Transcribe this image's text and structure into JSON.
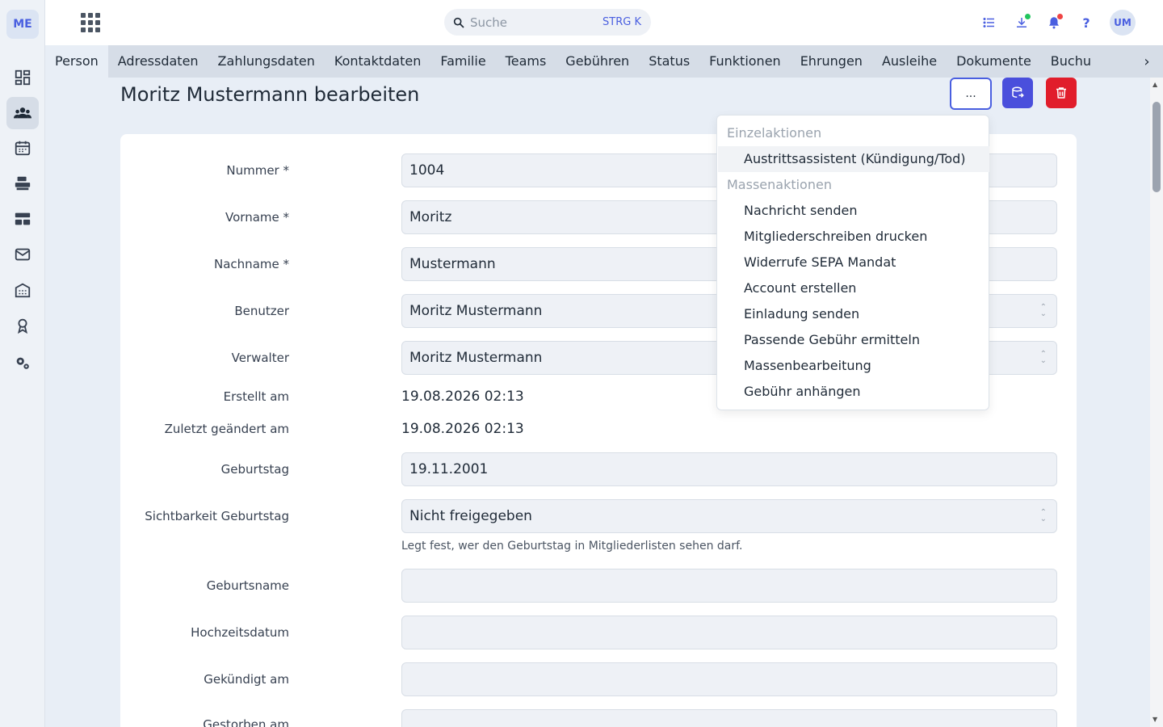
{
  "rail": {
    "logo": "ME",
    "items": [
      "dashboard-icon",
      "members-icon",
      "calendar-icon",
      "printer-icon",
      "table-icon",
      "mail-icon",
      "building-icon",
      "award-icon",
      "settings-icon"
    ],
    "active_index": 1
  },
  "topbar": {
    "search_placeholder": "Suche",
    "search_shortcut": "STRG K",
    "help_label": "?",
    "avatar": "UM"
  },
  "tabs": [
    "Person",
    "Adressdaten",
    "Zahlungsdaten",
    "Kontaktdaten",
    "Familie",
    "Teams",
    "Gebühren",
    "Status",
    "Funktionen",
    "Ehrungen",
    "Ausleihe",
    "Dokumente",
    "Buchu"
  ],
  "active_tab": "Person",
  "page": {
    "title": "Moritz Mustermann bearbeiten",
    "more_label": "...",
    "accent": "#4a5fe0",
    "delete_color": "#e11d2b"
  },
  "form": {
    "nummer_label": "Nummer *",
    "nummer_value": "1004",
    "vorname_label": "Vorname *",
    "vorname_value": "Moritz",
    "nachname_label": "Nachname *",
    "nachname_value": "Mustermann",
    "benutzer_label": "Benutzer",
    "benutzer_value": "Moritz Mustermann",
    "verwalter_label": "Verwalter",
    "verwalter_value": "Moritz Mustermann",
    "erstellt_label": "Erstellt am",
    "erstellt_value": "19.08.2026 02:13",
    "geaendert_label": "Zuletzt geändert am",
    "geaendert_value": "19.08.2026 02:13",
    "geburtstag_label": "Geburtstag",
    "geburtstag_value": "19.11.2001",
    "sichtbarkeit_label": "Sichtbarkeit Geburtstag",
    "sichtbarkeit_value": "Nicht freigegeben",
    "sichtbarkeit_hint": "Legt fest, wer den Geburtstag in Mitgliederlisten sehen darf.",
    "geburtsname_label": "Geburtsname",
    "hochzeitsdatum_label": "Hochzeitsdatum",
    "gekuendigt_label": "Gekündigt am",
    "gestorben_label": "Gestorben am"
  },
  "dropdown": {
    "einzel_header": "Einzelaktionen",
    "einzel_items": [
      "Austrittsassistent (Kündigung/Tod)"
    ],
    "massen_header": "Massenaktionen",
    "massen_items": [
      "Nachricht senden",
      "Mitgliederschreiben drucken",
      "Widerrufe SEPA Mandat",
      "Account erstellen",
      "Einladung senden",
      "Passende Gebühr ermitteln",
      "Massenbearbeitung",
      "Gebühr anhängen"
    ]
  }
}
